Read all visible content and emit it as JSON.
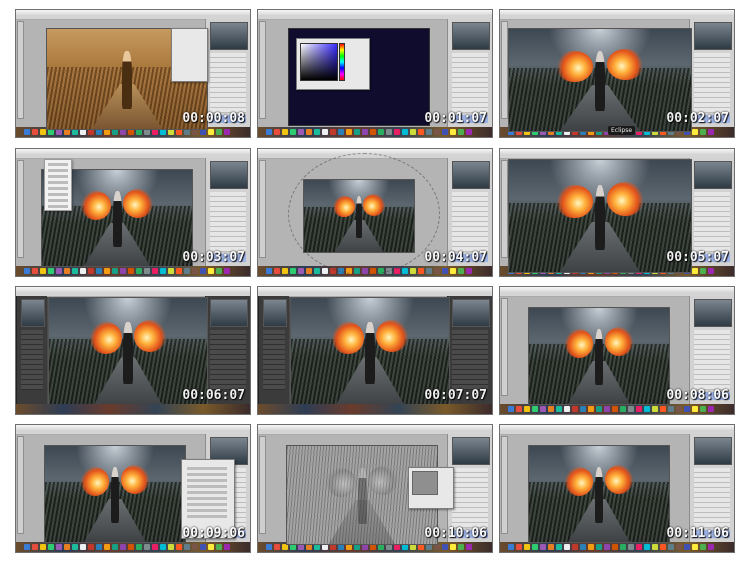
{
  "contact_sheet": {
    "frames": [
      {
        "timestamp": "00:00:08",
        "state": "sepia image with adjustment panel"
      },
      {
        "timestamp": "00:01:07",
        "state": "color picker dialog on dark navy canvas"
      },
      {
        "timestamp": "00:02:07",
        "state": "fire wings composite full canvas",
        "tooltip": "Eclipse"
      },
      {
        "timestamp": "00:03:07",
        "state": "menu open over composite"
      },
      {
        "timestamp": "00:04:07",
        "state": "composite with circular guide"
      },
      {
        "timestamp": "00:05:07",
        "state": "zoomed composite"
      },
      {
        "timestamp": "00:06:07",
        "state": "dark interface composite"
      },
      {
        "timestamp": "00:07:07",
        "state": "dark interface composite"
      },
      {
        "timestamp": "00:08:06",
        "state": "composite centered"
      },
      {
        "timestamp": "00:09:06",
        "state": "composite with settings dialog"
      },
      {
        "timestamp": "00:10:06",
        "state": "high pass filter gray preview"
      },
      {
        "timestamp": "00:11:06",
        "state": "composite final"
      }
    ]
  },
  "colors": {
    "background": "#ffffff",
    "timestamp_text": "#ffffff",
    "workspace_gray": "#b4b4b4",
    "navy_canvas": "#0f0c2e",
    "fire_orange": "#e2521a"
  }
}
